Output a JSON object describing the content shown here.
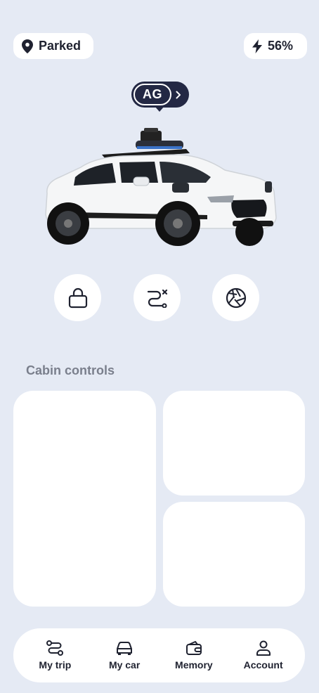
{
  "status": {
    "label": "Parked",
    "icon": "location-pin-icon"
  },
  "battery": {
    "label": "56%",
    "icon": "lightning-icon"
  },
  "vehicle": {
    "id": "AG",
    "icon": "chevron-right-icon"
  },
  "actions": [
    {
      "name": "lock",
      "icon": "lock-icon"
    },
    {
      "name": "route",
      "icon": "route-icon"
    },
    {
      "name": "camera",
      "icon": "aperture-icon"
    }
  ],
  "cabin": {
    "title": "Cabin controls"
  },
  "tabs": [
    {
      "label": "My trip",
      "icon": "route-icon"
    },
    {
      "label": "My car",
      "icon": "car-icon"
    },
    {
      "label": "Memory",
      "icon": "wallet-icon"
    },
    {
      "label": "Account",
      "icon": "person-icon"
    }
  ],
  "colors": {
    "background": "#e5eaf4",
    "surface": "#ffffff",
    "badge": "#232844",
    "text": "#1f2230",
    "muted": "#7a7f8c"
  }
}
